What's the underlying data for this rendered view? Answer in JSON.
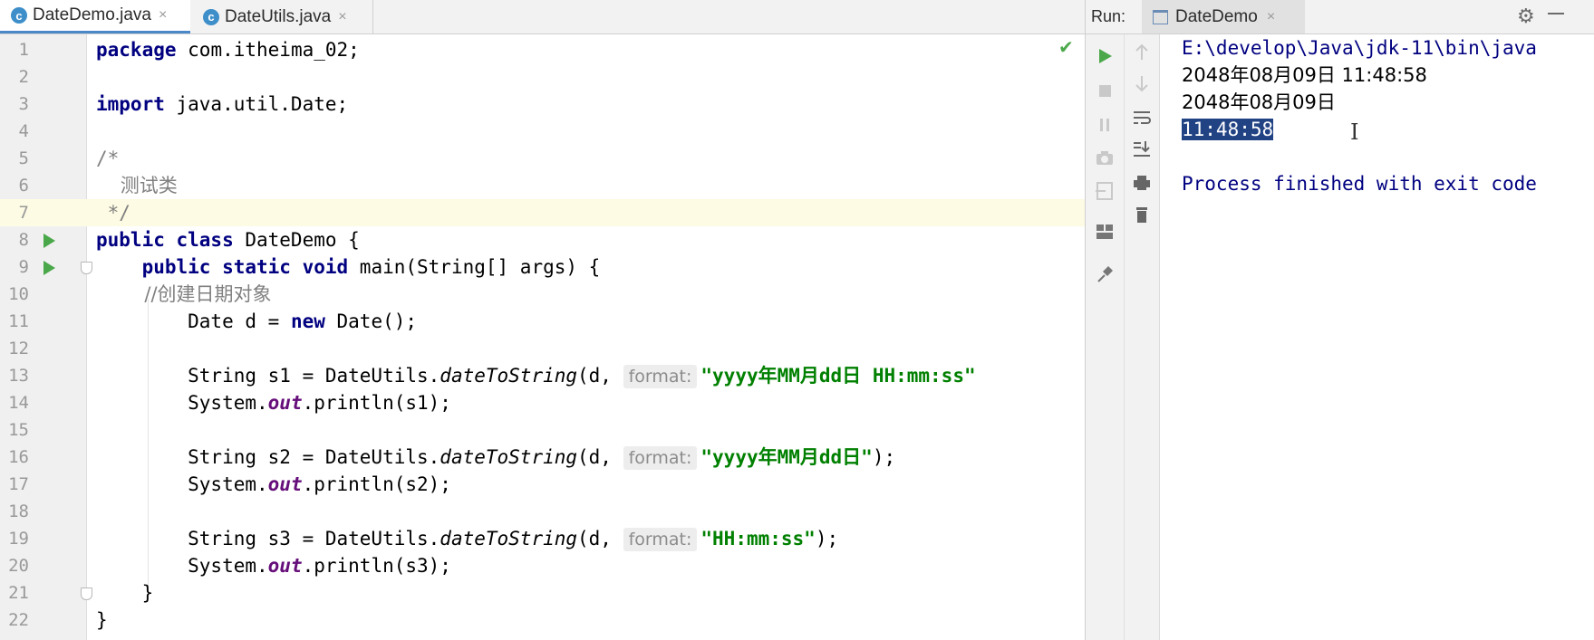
{
  "editor": {
    "tabs": [
      {
        "label": "DateDemo.java",
        "icon": "java-class-icon",
        "active": true
      },
      {
        "label": "DateUtils.java",
        "icon": "java-class-icon",
        "active": false
      }
    ],
    "close_glyph": "×",
    "line_numbers": [
      "1",
      "2",
      "3",
      "4",
      "5",
      "6",
      "7",
      "8",
      "9",
      "10",
      "11",
      "12",
      "13",
      "14",
      "15",
      "16",
      "17",
      "18",
      "19",
      "20",
      "21",
      "22"
    ],
    "code": {
      "l1_kw": "package",
      "l1_rest": " com.itheima_02;",
      "l3_kw": "import",
      "l3_rest": " java.util.Date;",
      "l5": "/*",
      "l6": "    测试类",
      "l7": " */",
      "l8_kw": "public class",
      "l8_rest": " DateDemo {",
      "l9_indent": "    ",
      "l9_kw": "public static void",
      "l9_rest": " main(String[] args) {",
      "l10": "        //创建日期对象",
      "l11_pre": "        Date d = ",
      "l11_kw": "new",
      "l11_post": " Date();",
      "l13_pre": "        String s1 = DateUtils.",
      "l13_method": "dateToString",
      "l13_mid": "(d, ",
      "l13_hint": "format:",
      "l13_str": "\"yyyy年MM月dd日 HH:mm:ss\"",
      "l14_pre": "        System.",
      "l14_out": "out",
      "l14_post": ".println(s1);",
      "l16_pre": "        String s2 = DateUtils.",
      "l16_method": "dateToString",
      "l16_mid": "(d, ",
      "l16_hint": "format:",
      "l16_str": "\"yyyy年MM月dd日\"",
      "l16_post": ");",
      "l17_pre": "        System.",
      "l17_out": "out",
      "l17_post": ".println(s2);",
      "l19_pre": "        String s3 = DateUtils.",
      "l19_method": "dateToString",
      "l19_mid": "(d, ",
      "l19_hint": "format:",
      "l19_str": "\"HH:mm:ss\"",
      "l19_post": ");",
      "l20_pre": "        System.",
      "l20_out": "out",
      "l20_post": ".println(s3);",
      "l21": "    }",
      "l22": "}"
    }
  },
  "run_panel": {
    "label": "Run:",
    "tab_label": "DateDemo",
    "console": {
      "path": "E:\\develop\\Java\\jdk-11\\bin\\java",
      "out1": "2048年08月09日 11:48:58",
      "out2": "2048年08月09日",
      "out3": "11:48:58",
      "finished": "Process finished with exit code"
    }
  },
  "colors": {
    "keyword": "#000080",
    "string": "#008000",
    "comment": "#808080",
    "field": "#660e7a",
    "selection": "#214283",
    "run_green": "#4aa84a"
  }
}
